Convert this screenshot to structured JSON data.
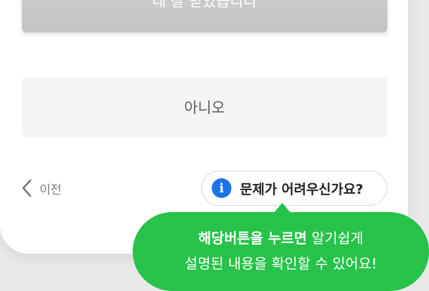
{
  "buttons": {
    "yes_label": "네 잘 받았습니다",
    "no_label": "아니오"
  },
  "nav": {
    "prev_label": "이전",
    "prev_icon": "chevron-left-icon"
  },
  "help": {
    "icon": "info-icon",
    "icon_glyph": "i",
    "label": "문제가 어려우신가요?"
  },
  "tooltip": {
    "line1_bold": "해당버튼을 누르면",
    "line1_rest": " 알기쉽게",
    "line2": "설명된 내용을 확인할 수 있어요!"
  },
  "colors": {
    "accent_blue": "#1c73e8",
    "tooltip_green": "#27c24a"
  }
}
